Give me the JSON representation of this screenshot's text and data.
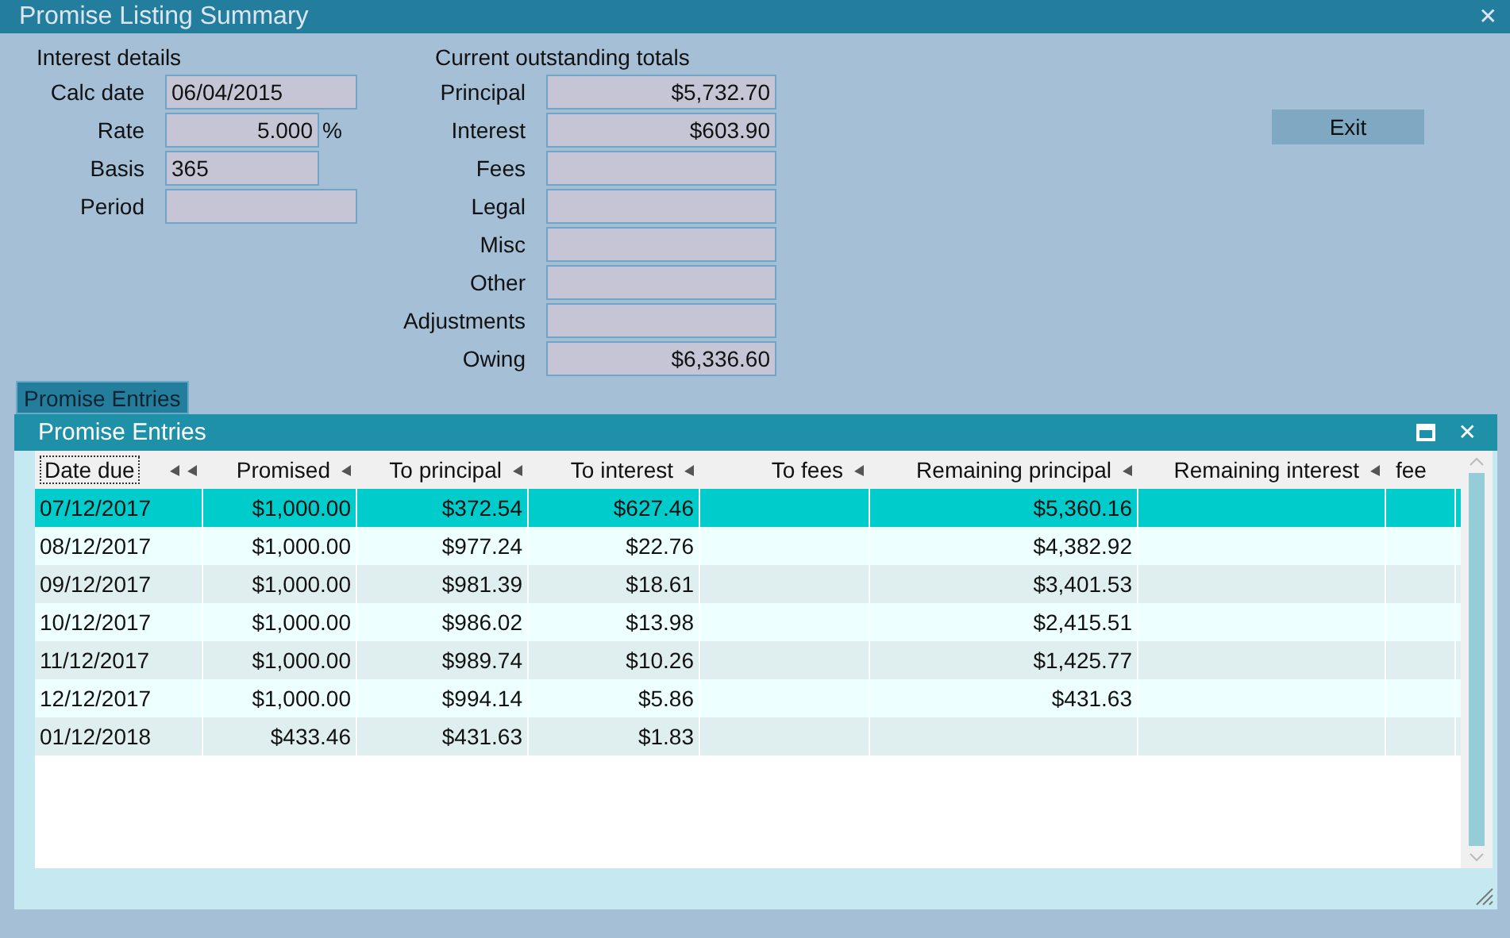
{
  "window": {
    "title": "Promise Listing Summary",
    "close": "✕"
  },
  "interest_details": {
    "heading": "Interest details",
    "fields": [
      {
        "label": "Calc date",
        "value": "06/04/2015",
        "kind": "text"
      },
      {
        "label": "Rate",
        "value": "5.000",
        "kind": "percent",
        "suffix": "%"
      },
      {
        "label": "Basis",
        "value": "365",
        "kind": "short"
      },
      {
        "label": "Period",
        "kind": "text"
      }
    ]
  },
  "totals": {
    "heading": "Current outstanding totals",
    "fields": [
      {
        "label": "Principal",
        "value": "$5,732.70"
      },
      {
        "label": "Interest",
        "value": "$603.90"
      },
      {
        "label": "Fees"
      },
      {
        "label": "Legal"
      },
      {
        "label": "Misc"
      },
      {
        "label": "Other"
      },
      {
        "label": "Adjustments"
      },
      {
        "label": "Owing",
        "value": "$6,336.60"
      }
    ]
  },
  "exit_button": {
    "label": "Exit"
  },
  "tab": {
    "label": "Promise Entries"
  },
  "panel": {
    "title": "Promise Entries",
    "close": "✕",
    "columns": [
      {
        "label": "Date due",
        "focused": true
      },
      {
        "label": "Promised",
        "focused": false
      },
      {
        "label": "To principal",
        "focused": false
      },
      {
        "label": "To interest",
        "focused": false
      },
      {
        "label": "To fees",
        "focused": false
      },
      {
        "label": "Remaining principal",
        "focused": false
      },
      {
        "label": "Remaining interest",
        "focused": false
      },
      {
        "label": "fee",
        "focused": false
      }
    ],
    "rows": [
      {
        "selected": true,
        "date": "07/12/2017",
        "promised": "$1,000.00",
        "to_principal": "$372.54",
        "to_interest": "$627.46",
        "remaining_principal": "$5,360.16"
      },
      {
        "selected": false,
        "date": "08/12/2017",
        "promised": "$1,000.00",
        "to_principal": "$977.24",
        "to_interest": "$22.76",
        "remaining_principal": "$4,382.92"
      },
      {
        "selected": false,
        "date": "09/12/2017",
        "promised": "$1,000.00",
        "to_principal": "$981.39",
        "to_interest": "$18.61",
        "remaining_principal": "$3,401.53"
      },
      {
        "selected": false,
        "date": "10/12/2017",
        "promised": "$1,000.00",
        "to_principal": "$986.02",
        "to_interest": "$13.98",
        "remaining_principal": "$2,415.51"
      },
      {
        "selected": false,
        "date": "11/12/2017",
        "promised": "$1,000.00",
        "to_principal": "$989.74",
        "to_interest": "$10.26",
        "remaining_principal": "$1,425.77"
      },
      {
        "selected": false,
        "date": "12/12/2017",
        "promised": "$1,000.00",
        "to_principal": "$994.14",
        "to_interest": "$5.86",
        "remaining_principal": "$431.63"
      },
      {
        "selected": false,
        "date": "01/12/2018",
        "promised": "$433.46",
        "to_principal": "$431.63",
        "to_interest": "$1.83"
      }
    ]
  }
}
